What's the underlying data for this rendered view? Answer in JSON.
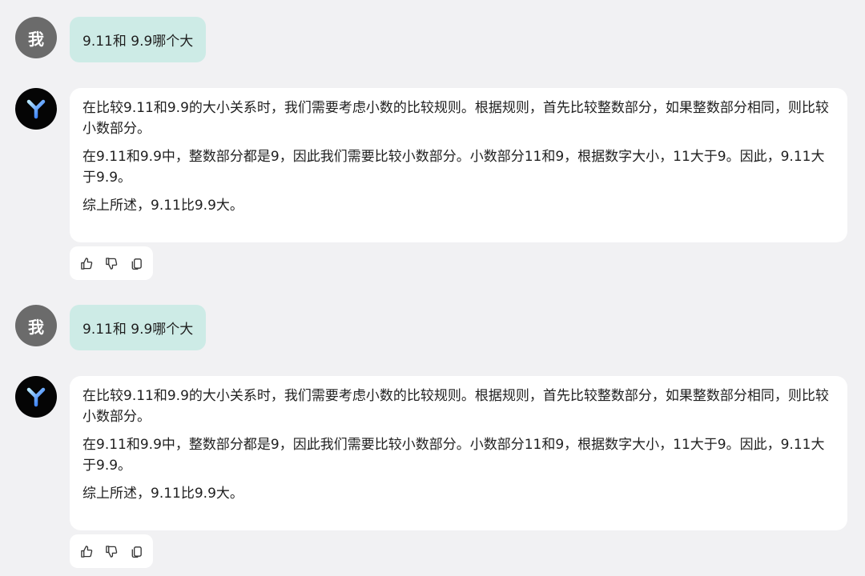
{
  "messages": [
    {
      "user": {
        "avatar_text": "我",
        "text": "9.11和 9.9哪个大"
      },
      "bot": {
        "avatar_icon": "y-logo-icon",
        "paragraphs": [
          "在比较9.11和9.9的大小关系时，我们需要考虑小数的比较规则。根据规则，首先比较整数部分，如果整数部分相同，则比较小数部分。",
          "在9.11和9.9中，整数部分都是9，因此我们需要比较小数部分。小数部分11和9，根据数字大小，11大于9。因此，9.11大于9.9。",
          "综上所述，9.11比9.9大。"
        ],
        "actions": [
          "thumbs-up-icon",
          "thumbs-down-icon",
          "copy-icon"
        ]
      }
    },
    {
      "user": {
        "avatar_text": "我",
        "text": "9.11和 9.9哪个大"
      },
      "bot": {
        "avatar_icon": "y-logo-icon",
        "paragraphs": [
          "在比较9.11和9.9的大小关系时，我们需要考虑小数的比较规则。根据规则，首先比较整数部分，如果整数部分相同，则比较小数部分。",
          "在9.11和9.9中，整数部分都是9，因此我们需要比较小数部分。小数部分11和9，根据数字大小，11大于9。因此，9.11大于9.9。",
          "综上所述，9.11比9.9大。"
        ],
        "actions": [
          "thumbs-up-icon",
          "thumbs-down-icon",
          "copy-icon"
        ]
      }
    }
  ],
  "colors": {
    "background": "#f1f1f3",
    "user_bubble": "#cdebe6",
    "user_avatar": "#6b6b6b",
    "bot_avatar": "#050505",
    "logo_gradient_start": "#9ad8ff",
    "logo_gradient_end": "#1f6bff"
  }
}
